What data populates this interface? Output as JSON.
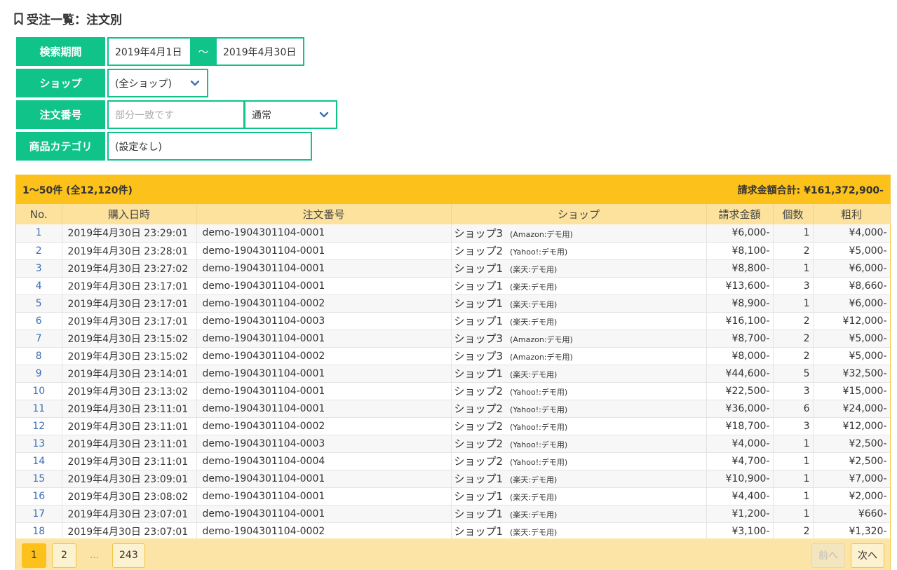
{
  "page": {
    "title": "受注一覧：注文別"
  },
  "filters": {
    "period_label": "検索期間",
    "date_from": "2019年4月1日",
    "date_sep": "〜",
    "date_to": "2019年4月30日",
    "shop_label": "ショップ",
    "shop_value": "(全ショップ)",
    "order_label": "注文番号",
    "order_placeholder": "部分一致です",
    "order_mode": "通常",
    "category_label": "商品カテゴリ",
    "category_value": "(設定なし)"
  },
  "summary": {
    "range": "1〜50件 (全12,120件)",
    "total": "請求金額合計: ¥161,372,900-"
  },
  "table": {
    "headers": [
      "No.",
      "購入日時",
      "注文番号",
      "ショップ",
      "請求金額",
      "個数",
      "粗利"
    ],
    "rows": [
      [
        "1",
        "2019年4月30日 23:29:01",
        "demo-1904301104-0001",
        "ショップ3",
        "(Amazon:デモ用)",
        "¥6,000-",
        "1",
        "¥4,000-"
      ],
      [
        "2",
        "2019年4月30日 23:28:01",
        "demo-1904301104-0001",
        "ショップ2",
        "(Yahoo!:デモ用)",
        "¥8,100-",
        "2",
        "¥5,000-"
      ],
      [
        "3",
        "2019年4月30日 23:27:02",
        "demo-1904301104-0001",
        "ショップ1",
        "(楽天:デモ用)",
        "¥8,800-",
        "1",
        "¥6,000-"
      ],
      [
        "4",
        "2019年4月30日 23:17:01",
        "demo-1904301104-0001",
        "ショップ1",
        "(楽天:デモ用)",
        "¥13,600-",
        "3",
        "¥8,660-"
      ],
      [
        "5",
        "2019年4月30日 23:17:01",
        "demo-1904301104-0002",
        "ショップ1",
        "(楽天:デモ用)",
        "¥8,900-",
        "1",
        "¥6,000-"
      ],
      [
        "6",
        "2019年4月30日 23:17:01",
        "demo-1904301104-0003",
        "ショップ1",
        "(楽天:デモ用)",
        "¥16,100-",
        "2",
        "¥12,000-"
      ],
      [
        "7",
        "2019年4月30日 23:15:02",
        "demo-1904301104-0001",
        "ショップ3",
        "(Amazon:デモ用)",
        "¥8,700-",
        "2",
        "¥5,000-"
      ],
      [
        "8",
        "2019年4月30日 23:15:02",
        "demo-1904301104-0002",
        "ショップ3",
        "(Amazon:デモ用)",
        "¥8,000-",
        "2",
        "¥5,000-"
      ],
      [
        "9",
        "2019年4月30日 23:14:01",
        "demo-1904301104-0001",
        "ショップ1",
        "(楽天:デモ用)",
        "¥44,600-",
        "5",
        "¥32,500-"
      ],
      [
        "10",
        "2019年4月30日 23:13:02",
        "demo-1904301104-0001",
        "ショップ2",
        "(Yahoo!:デモ用)",
        "¥22,500-",
        "3",
        "¥15,000-"
      ],
      [
        "11",
        "2019年4月30日 23:11:01",
        "demo-1904301104-0001",
        "ショップ2",
        "(Yahoo!:デモ用)",
        "¥36,000-",
        "6",
        "¥24,000-"
      ],
      [
        "12",
        "2019年4月30日 23:11:01",
        "demo-1904301104-0002",
        "ショップ2",
        "(Yahoo!:デモ用)",
        "¥18,700-",
        "3",
        "¥12,000-"
      ],
      [
        "13",
        "2019年4月30日 23:11:01",
        "demo-1904301104-0003",
        "ショップ2",
        "(Yahoo!:デモ用)",
        "¥4,000-",
        "1",
        "¥2,500-"
      ],
      [
        "14",
        "2019年4月30日 23:11:01",
        "demo-1904301104-0004",
        "ショップ2",
        "(Yahoo!:デモ用)",
        "¥4,700-",
        "1",
        "¥2,500-"
      ],
      [
        "15",
        "2019年4月30日 23:09:01",
        "demo-1904301104-0001",
        "ショップ1",
        "(楽天:デモ用)",
        "¥10,900-",
        "1",
        "¥7,000-"
      ],
      [
        "16",
        "2019年4月30日 23:08:02",
        "demo-1904301104-0001",
        "ショップ1",
        "(楽天:デモ用)",
        "¥4,400-",
        "1",
        "¥2,000-"
      ],
      [
        "17",
        "2019年4月30日 23:07:01",
        "demo-1904301104-0001",
        "ショップ1",
        "(楽天:デモ用)",
        "¥1,200-",
        "1",
        "¥660-"
      ],
      [
        "18",
        "2019年4月30日 23:07:01",
        "demo-1904301104-0002",
        "ショップ1",
        "(楽天:デモ用)",
        "¥3,100-",
        "2",
        "¥1,320-"
      ]
    ]
  },
  "pager": {
    "pages": [
      "1",
      "2"
    ],
    "ellipsis": "...",
    "last": "243",
    "prev": "前へ",
    "next": "次へ"
  },
  "colors": {
    "accent": "#0fc389",
    "table_header": "#fcc11b",
    "link": "#3a6fb5"
  },
  "icons": {
    "title": "bookmark-icon",
    "dropdown": "chevron-down-icon"
  }
}
